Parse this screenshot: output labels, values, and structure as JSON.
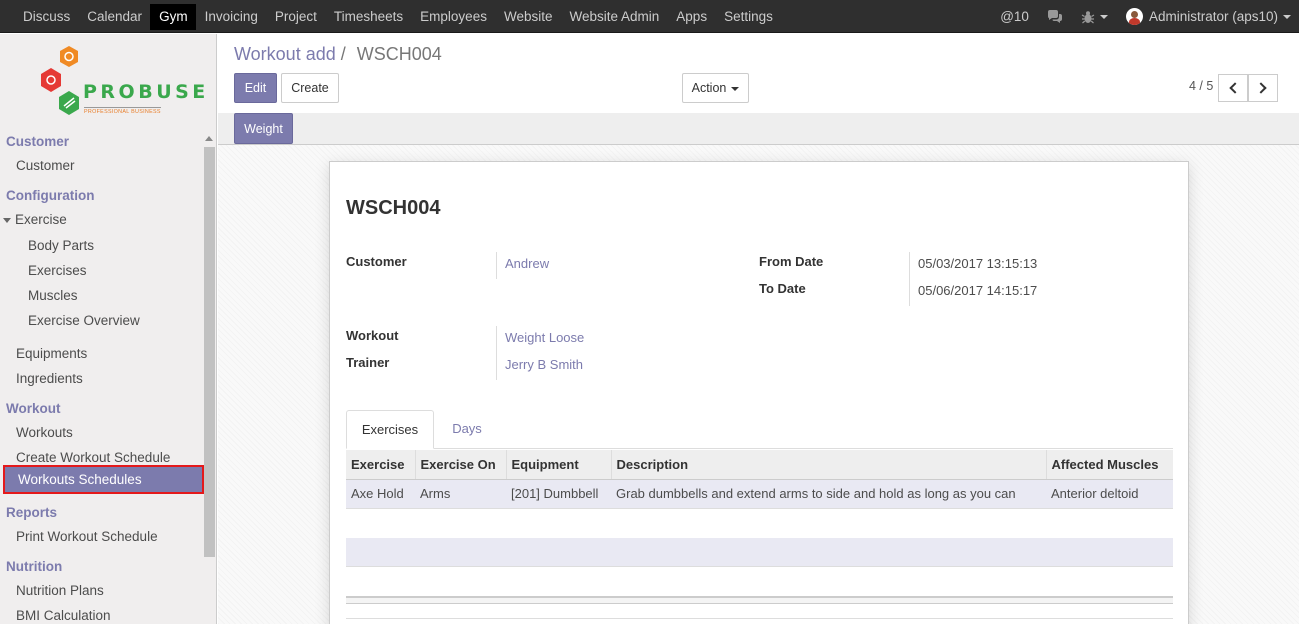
{
  "topbar": {
    "menus": [
      "Discuss",
      "Calendar",
      "Gym",
      "Invoicing",
      "Project",
      "Timesheets",
      "Employees",
      "Website",
      "Website Admin",
      "Apps",
      "Settings"
    ],
    "active_menu": "Gym",
    "mentions": "@10",
    "user": "Administrator (aps10)"
  },
  "logo": {
    "name": "PROBUSE",
    "tagline": "PROFESSIONAL BUSINESS"
  },
  "sidebar": {
    "customer_section": "Customer",
    "customer": "Customer",
    "configuration_section": "Configuration",
    "exercise": "Exercise",
    "body_parts": "Body Parts",
    "exercises": "Exercises",
    "muscles": "Muscles",
    "exercise_overview": "Exercise Overview",
    "equipments": "Equipments",
    "ingredients": "Ingredients",
    "workout_section": "Workout",
    "workouts": "Workouts",
    "create_workout_schedule": "Create Workout Schedule",
    "workouts_schedules": "Workouts Schedules",
    "reports_section": "Reports",
    "print_workout_schedule": "Print Workout Schedule",
    "nutrition_section": "Nutrition",
    "nutrition_plans": "Nutrition Plans",
    "bmi_calculation": "BMI Calculation"
  },
  "breadcrumb": {
    "parent": "Workout add",
    "separator": "/",
    "current": "WSCH004"
  },
  "buttons": {
    "edit": "Edit",
    "create": "Create",
    "action": "Action",
    "weight": "Weight"
  },
  "pager": {
    "value": "4 / 5"
  },
  "form": {
    "title": "WSCH004",
    "customer_label": "Customer",
    "customer_value": "Andrew",
    "from_date_label": "From Date",
    "from_date_value": "05/03/2017 13:15:13",
    "to_date_label": "To Date",
    "to_date_value": "05/06/2017 14:15:17",
    "workout_label": "Workout",
    "workout_value": "Weight Loose",
    "trainer_label": "Trainer",
    "trainer_value": "Jerry B Smith"
  },
  "tabs": [
    "Exercises",
    "Days"
  ],
  "table": {
    "columns": [
      "Exercise",
      "Exercise On",
      "Equipment",
      "Description",
      "Affected Muscles"
    ],
    "rows": [
      [
        "Axe Hold",
        "Arms",
        "[201] Dumbbell",
        "Grab dumbbells and extend arms to side and hold as long as you can",
        "Anterior deltoid"
      ]
    ]
  },
  "colors": {
    "accent": "#7c7bad",
    "topbar": "#2f2f2f",
    "highlight_border": "#e4191b"
  }
}
